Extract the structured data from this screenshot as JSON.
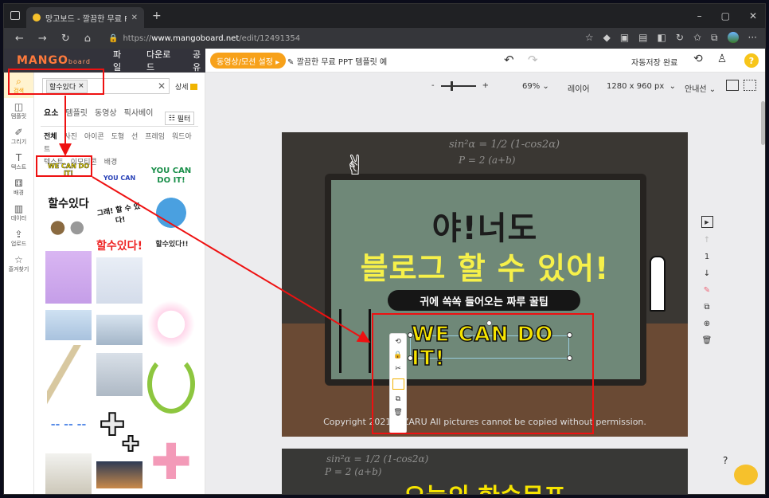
{
  "browser": {
    "tab_title": "망고보드 - 깔끔한 무료 PPT 템플",
    "url_prefix": "https://",
    "url_domain": "www.mangoboard.net",
    "url_path": "/edit/12491354"
  },
  "header": {
    "logo": "MANGO",
    "logo_sub": "board",
    "menu": [
      "파일",
      "다운로드",
      "공유"
    ],
    "play_button": "동영상/모션 설정 ▸",
    "doc_title": "깔끔한 무료 PPT 템플릿 예",
    "autosave": "자동저장 완료",
    "help": "?"
  },
  "rail": {
    "items": [
      {
        "label": "검색",
        "icon": "search-icon"
      },
      {
        "label": "템플릿",
        "icon": "template-icon"
      },
      {
        "label": "그리기",
        "icon": "draw-icon"
      },
      {
        "label": "텍스트",
        "icon": "text-icon"
      },
      {
        "label": "배경",
        "icon": "background-icon"
      },
      {
        "label": "데이터",
        "icon": "chart-icon"
      },
      {
        "label": "업로드",
        "icon": "upload-icon"
      },
      {
        "label": "즐겨찾기",
        "icon": "star-icon"
      }
    ]
  },
  "panel": {
    "search_chip": "할수있다",
    "detail": "상세",
    "tabs": [
      "요소",
      "템플릿",
      "동영상",
      "픽사베이"
    ],
    "filter": "필터",
    "subtabs_row1": [
      "전체",
      "사진",
      "아이콘",
      "도형",
      "선",
      "프레임",
      "워드아트"
    ],
    "subtabs_row2": [
      "텍스트",
      "이모티콘",
      "배경"
    ],
    "thumbs": {
      "t1": "WE CAN DO IT!",
      "t2": "YOU CAN",
      "t3": "YOU CAN DO IT!",
      "t4": "할수있다",
      "t5": "그래! 할 수 있다!",
      "t6": "할수있다!",
      "t7": "할수있다!!"
    }
  },
  "toolbar": {
    "zoom_minus": "-",
    "zoom_plus": "+",
    "zoom": "69%",
    "layer": "레이어",
    "size": "1280 x 960 px",
    "guide": "안내선"
  },
  "slide": {
    "title1": "야!너도",
    "title2": "블로그 할 수 있어!",
    "subtitle": "귀에 쏙쏙 들어오는 짜루 꿀팁",
    "selected_text": "WE CAN DO IT!",
    "copyright": "Copyright 2021. ZZARU All pictures cannot be copied without permission.",
    "formula1": "sin²α = 1/2 (1-cos2α)",
    "formula2": "P = 2 (a+b)",
    "slide2_title": "오늘의 한숨목표"
  },
  "page_nav": {
    "page": "1"
  }
}
